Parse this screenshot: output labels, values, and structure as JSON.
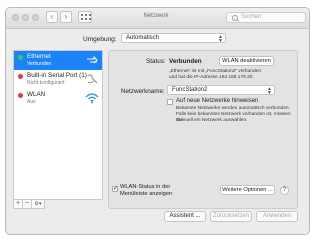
{
  "window": {
    "title": "Netzwerk",
    "search_placeholder": "Suchen",
    "back_symbol": "‹",
    "forward_symbol": "›"
  },
  "location": {
    "label": "Umgebung:",
    "value": "Automatisch"
  },
  "sidebar": {
    "items": [
      {
        "name": "Ethernet",
        "status": "Verbunden",
        "dot_color": "#3cc94a",
        "icon": "arrows-icon"
      },
      {
        "name": "Built-in Serial Port (1)",
        "status": "Nicht konfiguriert",
        "dot_color": "#e8353a",
        "icon": "phone-icon"
      },
      {
        "name": "WLAN",
        "status": "Aus",
        "dot_color": "#e8353a",
        "icon": "wifi-icon"
      }
    ],
    "add_symbol": "+",
    "remove_symbol": "−",
    "action_symbol": "⚙▾"
  },
  "details": {
    "status_label": "Status:",
    "status_value": "Verbunden",
    "toggle_button": "WLAN deaktivieren",
    "status_desc_1": "„Ethernet“ ist mit „FuncStation2“ verbunden",
    "status_desc_2": "und hat die IP-Adresse 192.168.178.20.",
    "network_label": "Netzwerkname:",
    "network_value": "FuncStation2",
    "ask_label": "Auf neue Netzwerke hinweisen",
    "ask_desc_1": "Bekannte Netzwerke werden automatisch verbunden.",
    "ask_desc_2": "Falls kein bekanntes Netzwerk vorhanden ist, müssen Sie",
    "ask_desc_3": "manuell ein Netzwerk auswählen.",
    "menubar_label_1": "WLAN-Status in der",
    "menubar_label_2": "Menüleiste anzeigen",
    "options_button": "Weitere Optionen ...",
    "help_symbol": "?"
  },
  "footer": {
    "assistant": "Assistent ...",
    "revert": "Zurücksetzen",
    "apply": "Anwenden"
  },
  "colors": {
    "selection": "#1a82fb",
    "connected": "#3cc94a",
    "inactive": "#e8353a"
  }
}
